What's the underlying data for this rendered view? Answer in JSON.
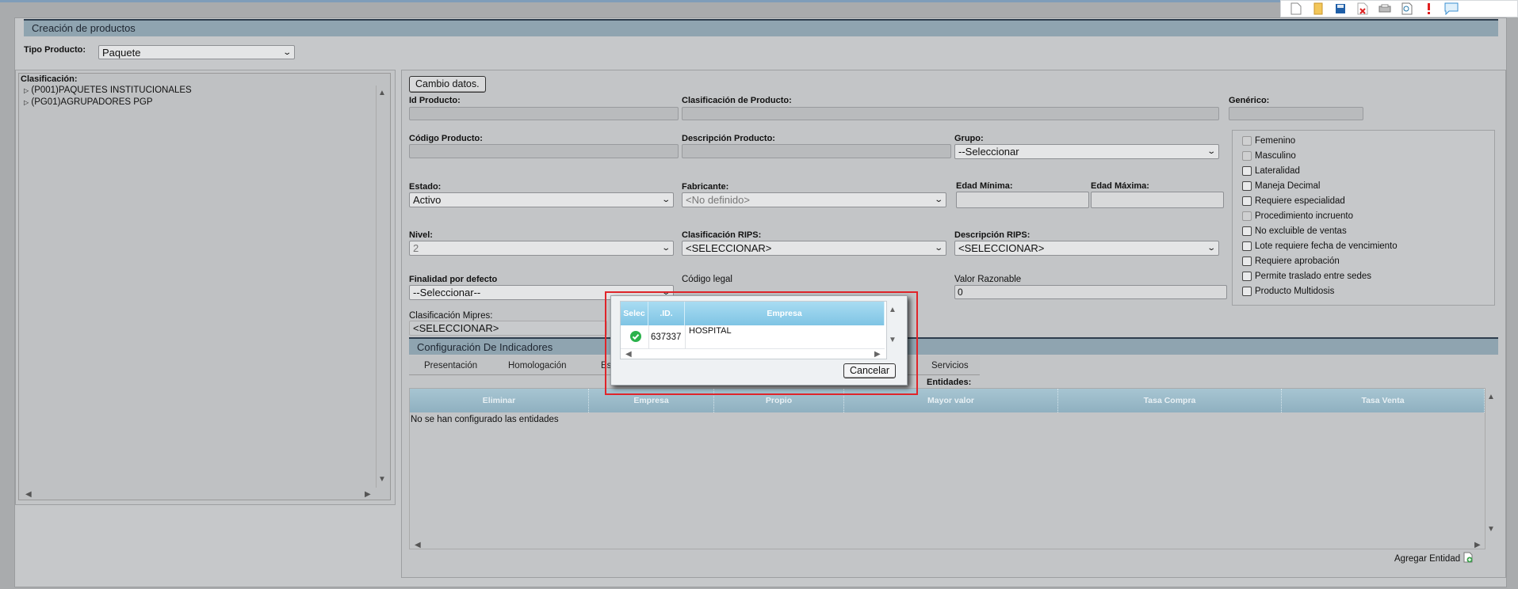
{
  "toolbar": {
    "icons": [
      "new-document-icon",
      "open-folder-icon",
      "save-icon",
      "delete-icon",
      "print-icon",
      "preview-icon",
      "alert-icon",
      "chat-icon"
    ]
  },
  "header": {
    "title": "Creación de productos",
    "tipo_producto_label": "Tipo Producto:",
    "tipo_producto_value": "Paquete"
  },
  "tree": {
    "label": "Clasificación:",
    "items": [
      "(P001)PAQUETES INSTITUCIONALES",
      "(PG01)AGRUPADORES PGP"
    ]
  },
  "form": {
    "change_button": "Cambio datos.",
    "id_producto_label": "Id Producto:",
    "clasificacion_producto_label": "Clasificación de Producto:",
    "generico_label": "Genérico:",
    "codigo_producto_label": "Código Producto:",
    "descripcion_producto_label": "Descripción Producto:",
    "grupo_label": "Grupo:",
    "grupo_value": "--Seleccionar",
    "estado_label": "Estado:",
    "estado_value": "Activo",
    "fabricante_label": "Fabricante:",
    "fabricante_value": "<No definido>",
    "edad_minima_label": "Edad Mínima:",
    "edad_maxima_label": "Edad Máxima:",
    "nivel_label": "Nivel:",
    "nivel_value": "2",
    "clasificacion_rips_label": "Clasificación RIPS:",
    "clasificacion_rips_value": "<SELECCIONAR>",
    "descripcion_rips_label": "Descripción RIPS:",
    "descripcion_rips_value": "<SELECCIONAR>",
    "finalidad_label": "Finalidad por defecto",
    "finalidad_value": "--Seleccionar--",
    "codigo_legal_label": "Código legal",
    "valor_razonable_label": "Valor Razonable",
    "valor_razonable_value": "0",
    "clasificacion_mipres_label": "Clasificación Mipres:",
    "clasificacion_mipres_value": "<SELECCIONAR>"
  },
  "checkboxes": [
    {
      "label": "Femenino",
      "disabled": true
    },
    {
      "label": "Masculino",
      "disabled": true
    },
    {
      "label": "Lateralidad",
      "disabled": false
    },
    {
      "label": "Maneja Decimal",
      "disabled": false
    },
    {
      "label": "Requiere especialidad",
      "disabled": false
    },
    {
      "label": "Procedimiento incruento",
      "disabled": true
    },
    {
      "label": "No excluible de ventas",
      "disabled": false
    },
    {
      "label": "Lote requiere fecha de vencimiento",
      "disabled": false
    },
    {
      "label": "Requiere aprobación",
      "disabled": false
    },
    {
      "label": "Permite traslado entre sedes",
      "disabled": false
    },
    {
      "label": "Producto Multidosis",
      "disabled": false
    }
  ],
  "indicators": {
    "title": "Configuración De Indicadores",
    "tabs": [
      "Presentación",
      "Homologación",
      "Es",
      "Servicios"
    ],
    "entidades_label": "Entidades:",
    "columns": [
      "Eliminar",
      "Empresa",
      "Propio",
      "Mayor valor",
      "Tasa Compra",
      "Tasa Venta"
    ],
    "empty_message": "No se han configurado las entidades",
    "add_label": "Agregar Entidad"
  },
  "modal": {
    "columns": [
      "Selec",
      ".ID.",
      "Empresa"
    ],
    "rows": [
      {
        "id": "637337",
        "empresa": "HOSPITAL"
      }
    ],
    "cancel_label": "Cancelar"
  },
  "colors": {
    "accent_red": "#e0252a",
    "grid_header": "#8fb0c0",
    "modal_header": "#7fc4e4",
    "check_green": "#2bb24c"
  }
}
